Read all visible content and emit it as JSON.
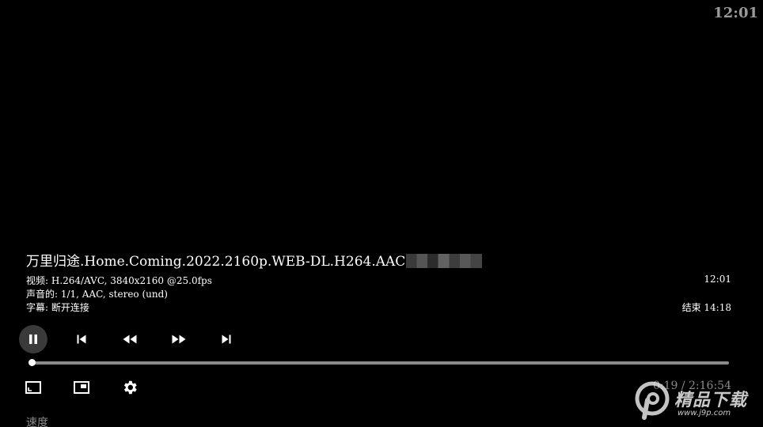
{
  "status": {
    "clock": "12:01"
  },
  "media": {
    "title": "万里归途.Home.Coming.2022.2160p.WEB-DL.H264.AAC",
    "video_info": "视频: H.264/AVC, 3840x2160 @25.0fps",
    "audio_info": "声音的: 1/1, AAC, stereo (und)",
    "subtitle_info": "字幕: 断开连接",
    "current_clock": "12:01",
    "end_time": "结束 14:18"
  },
  "playback": {
    "elapsed": "0:19",
    "separator": "/",
    "duration": "2:16:54",
    "progress_fraction": 0.0023
  },
  "menu": {
    "speed_label": "速度"
  },
  "watermark": {
    "text": "精品下载",
    "url": "www.j9p.com"
  },
  "icons": {
    "pause": "pause-icon",
    "previous": "skip-previous-icon",
    "rewind": "rewind-icon",
    "fast_forward": "fast-forward-icon",
    "next": "skip-next-icon",
    "aspect": "aspect-ratio-icon",
    "pip": "picture-in-picture-icon",
    "settings": "gear-icon"
  },
  "colors": {
    "background": "#000000",
    "text": "#ffffff",
    "muted": "#8a8a8a",
    "track": "#8a8a8a"
  }
}
